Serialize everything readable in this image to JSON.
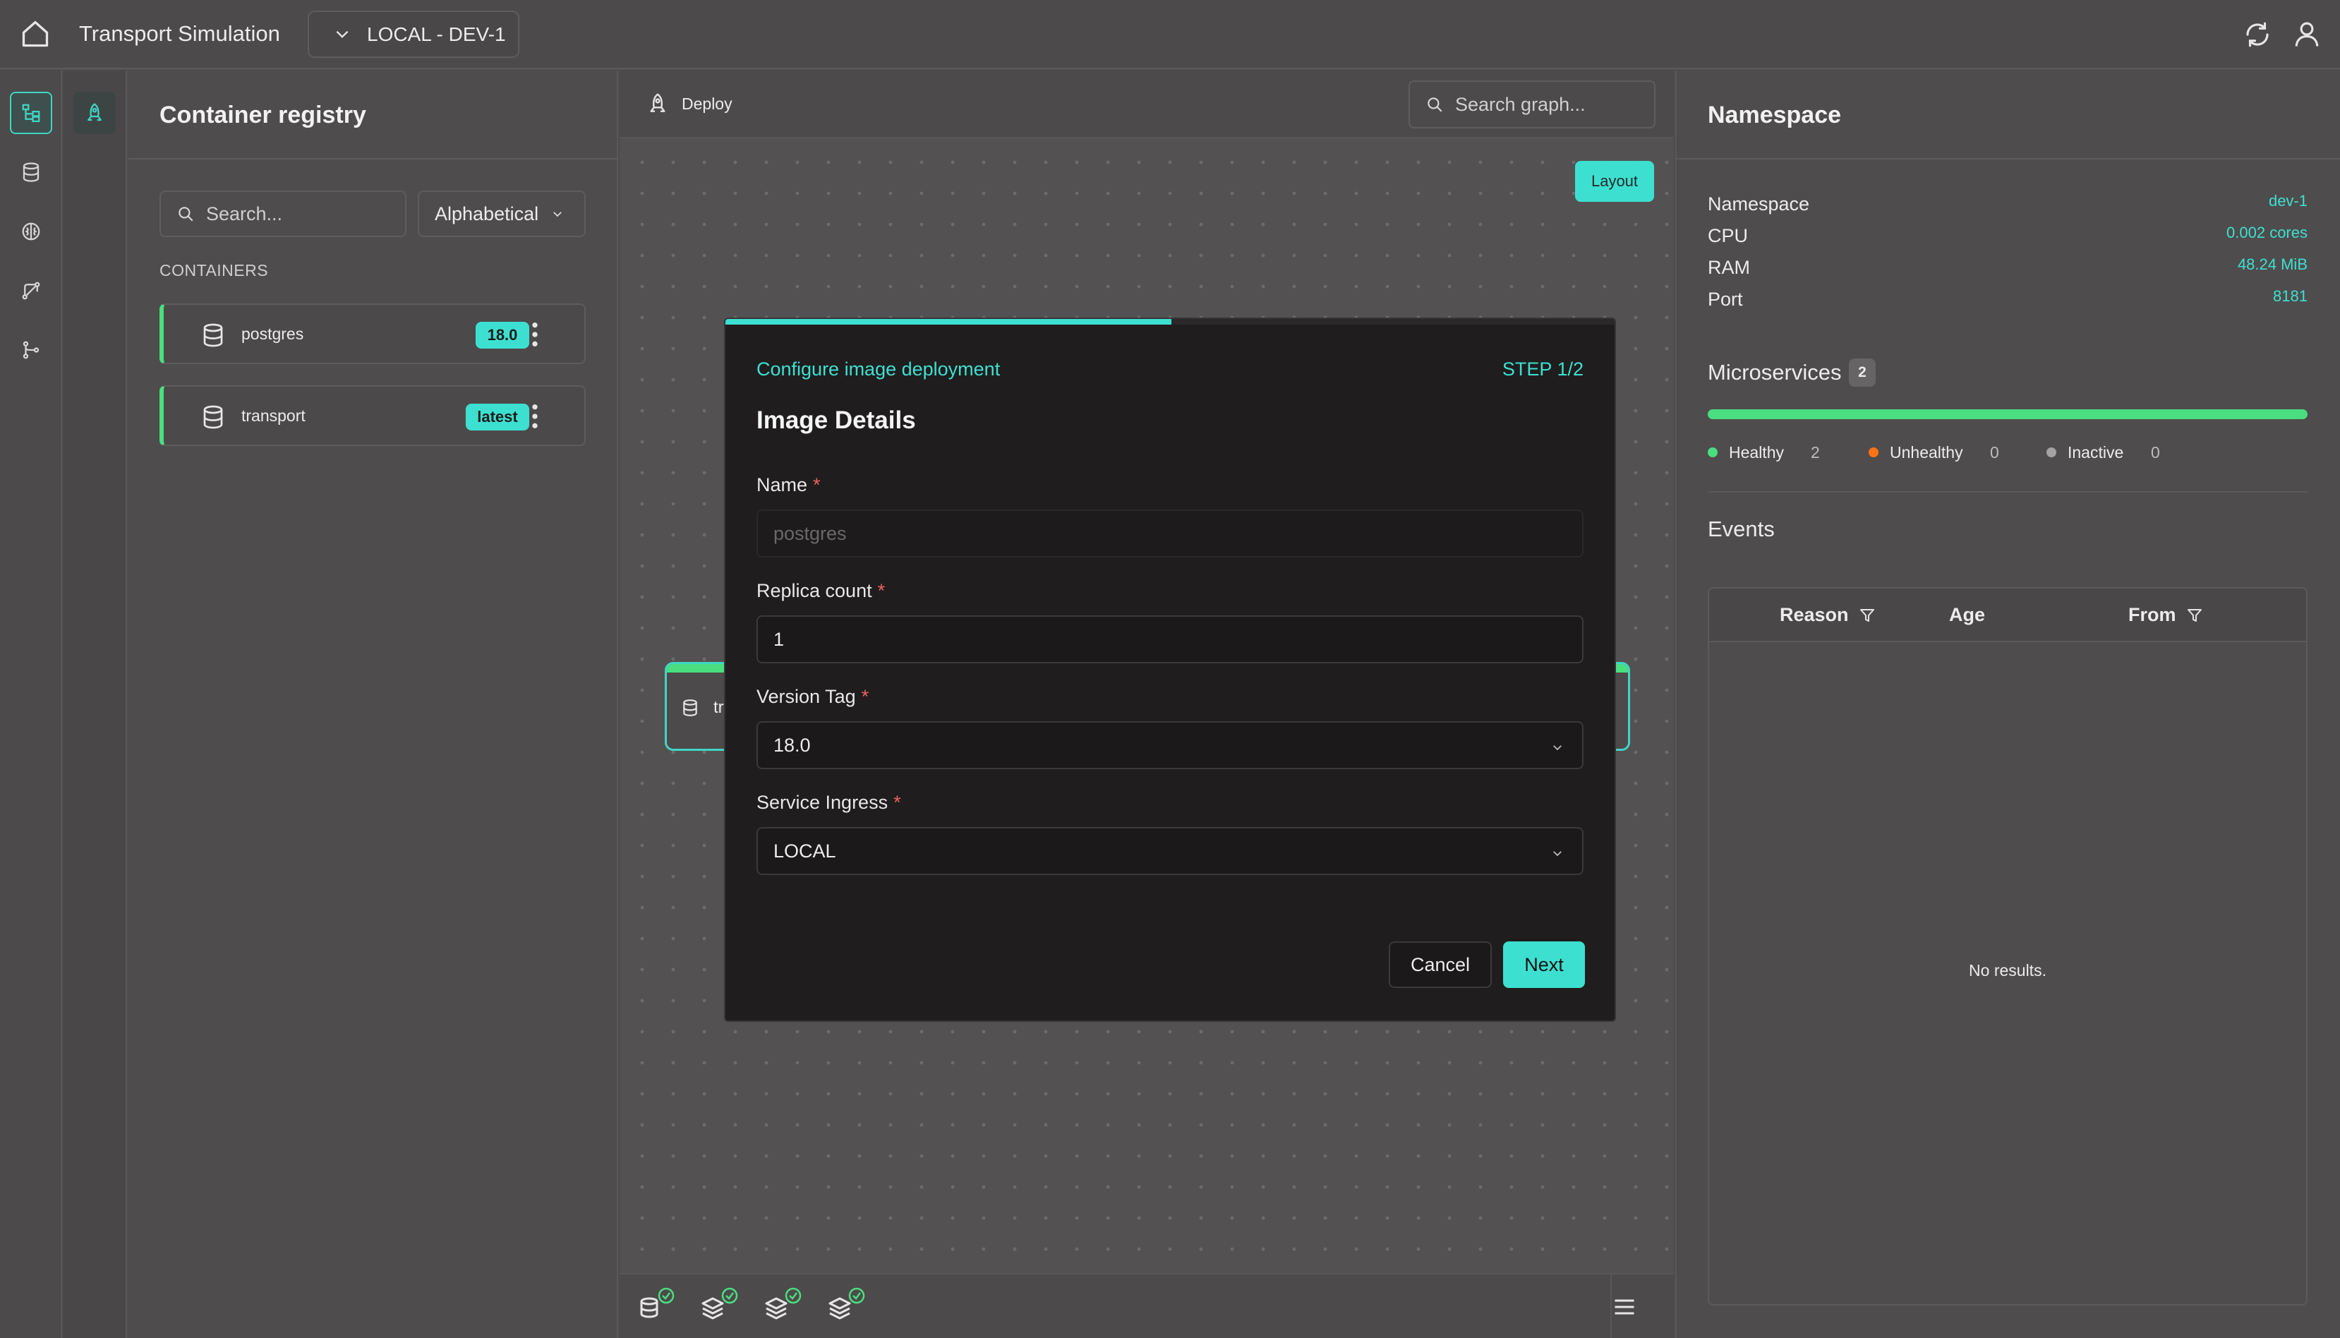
{
  "header": {
    "title": "Transport Simulation",
    "environment": "LOCAL - DEV-1"
  },
  "registry": {
    "title": "Container registry",
    "search_placeholder": "Search...",
    "sort": "Alphabetical",
    "section_label": "CONTAINERS",
    "containers": [
      {
        "name": "postgres",
        "tag": "18.0"
      },
      {
        "name": "transport",
        "tag": "latest"
      }
    ]
  },
  "graph": {
    "deploy_label": "Deploy",
    "search_placeholder": "Search graph...",
    "layout_label": "Layout",
    "node_label": "tr"
  },
  "modal": {
    "subtitle": "Configure image deployment",
    "step": "STEP 1/2",
    "progress": 0.5,
    "title": "Image Details",
    "fields": {
      "name": {
        "label": "Name",
        "required_mark": "*",
        "placeholder": "postgres"
      },
      "replicas": {
        "label": "Replica count",
        "required_mark": "*",
        "value": "1"
      },
      "version": {
        "label": "Version Tag",
        "required_mark": "*",
        "value": "18.0"
      },
      "ingress": {
        "label": "Service Ingress",
        "required_mark": "*",
        "value": "LOCAL"
      }
    },
    "cancel_label": "Cancel",
    "next_label": "Next"
  },
  "namespace": {
    "title": "Namespace",
    "rows": [
      {
        "key": "Namespace",
        "value": "dev-1"
      },
      {
        "key": "CPU",
        "value": "0.002 cores"
      },
      {
        "key": "RAM",
        "value": "48.24 MiB"
      },
      {
        "key": "Port",
        "value": "8181"
      }
    ],
    "microservices": {
      "title": "Microservices",
      "count": "2",
      "healthy_fraction": 1.0,
      "legend": [
        {
          "label": "Healthy",
          "count": "2",
          "color": "#4ade80"
        },
        {
          "label": "Unhealthy",
          "count": "0",
          "color": "#f97316"
        },
        {
          "label": "Inactive",
          "count": "0",
          "color": "#a3a3a3"
        }
      ]
    },
    "events": {
      "title": "Events",
      "columns": [
        "Reason",
        "Age",
        "From"
      ],
      "empty_text": "No results."
    }
  },
  "colors": {
    "accent": "#3de0d0",
    "healthy": "#4ade80",
    "required": "#f06060"
  },
  "icons": {
    "topbar": [
      "home-icon",
      "chevron-down-icon",
      "refresh-icon",
      "user-icon"
    ],
    "rail": [
      "hierarchy-icon",
      "database-icon",
      "brain-icon",
      "network-icon",
      "branch-icon"
    ],
    "bottom": [
      "database-icon",
      "layers-icon",
      "layers-icon",
      "layers-icon",
      "menu-icon"
    ]
  }
}
